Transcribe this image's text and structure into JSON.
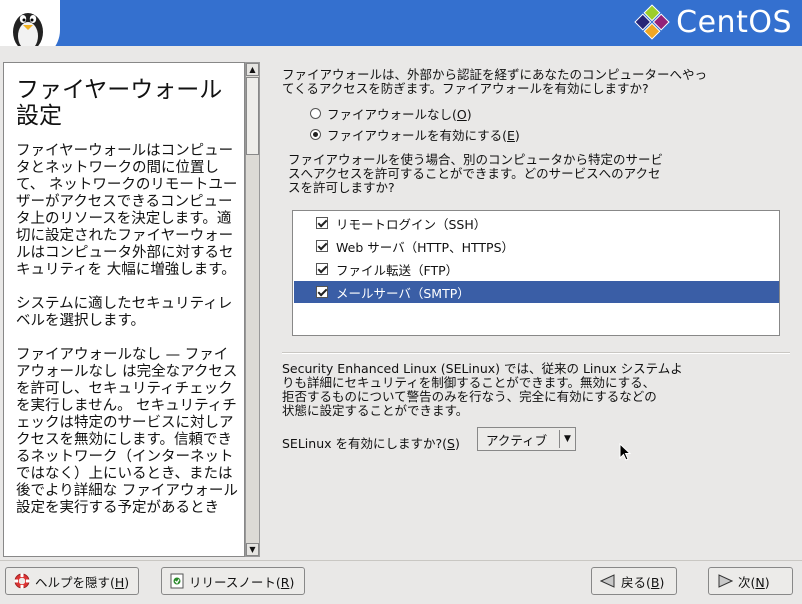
{
  "brand": {
    "name": "CentOS"
  },
  "help": {
    "title": "ファイヤーウォール設定",
    "paragraphs": [
      "ファイヤーウォールはコンピュータとネットワークの間に位置して、 ネットワークのリモートユーザーがアクセスできるコンピュータ上のリソースを決定します。適切に設定されたファイヤーウォールはコンピュータ外部に対するセキュリティを 大幅に増強します。",
      "システムに適したセキュリティレベルを選択します。",
      "ファイアウォールなし — ファイアウォールなし は完全なアクセスを許可し、セキュリティチェックを実行しません。 セキュリティチェックは特定のサービスに対しアクセスを無効にします。信頼できるネットワーク（インターネットではなく）上にいるとき、または後でより詳細な ファイアウォール設定を実行する予定があるとき"
    ]
  },
  "firewall": {
    "intro_line1": "ファイアウォールは、外部から認証を経ずにあなたのコンピューターへやっ",
    "intro_line2": "てくるアクセスを防ぎます。ファイアウォールを有効にしますか?",
    "option_none": "ファイアウォールなし(",
    "option_none_key": "O",
    "option_enable": "ファイアウォールを有効にする(",
    "option_enable_key": "E",
    "selected": "enable",
    "close_paren": ")"
  },
  "services": {
    "intro_line1": "ファイアウォールを使う場合、別のコンピュータから特定のサービ",
    "intro_line2": "スへアクセスを許可することができます。どのサービスへのアクセ",
    "intro_line3": "スを許可しますか?",
    "items": [
      {
        "label": "リモートログイン（SSH）",
        "checked": true,
        "selected": false
      },
      {
        "label": "Web サーバ（HTTP、HTTPS）",
        "checked": true,
        "selected": false
      },
      {
        "label": "ファイル転送（FTP）",
        "checked": true,
        "selected": false
      },
      {
        "label": "メールサーバ（SMTP）",
        "checked": true,
        "selected": true
      }
    ]
  },
  "selinux": {
    "text_line1": "Security Enhanced Linux (SELinux) では、従来の  Linux システムよ",
    "text_line2": "りも詳細にセキュリティを制御することができます。無効にする、",
    "text_line3": "拒否するものについて警告のみを行なう、完全に有効にするなどの",
    "text_line4": "状態に設定することができます。",
    "label": "SELinux を有効にしますか?(",
    "label_key": "S",
    "label_end": ")",
    "value": "アクティブ"
  },
  "buttons": {
    "hide_help": "ヘルプを隠す(",
    "hide_help_key": "H",
    "release_notes": "リリースノート(",
    "release_notes_key": "R",
    "back": "戻る(",
    "back_key": "B",
    "next": "次(",
    "next_key": "N",
    "close": ")"
  },
  "colors": {
    "header": "#3470cf",
    "selection": "#3a5ea6"
  }
}
